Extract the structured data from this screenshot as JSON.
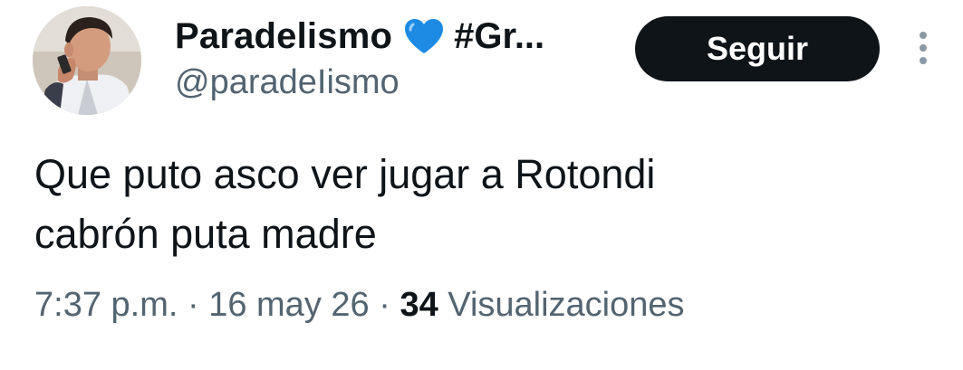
{
  "tweet": {
    "author": {
      "display_name": "Paradelismo",
      "emoji_icon": "blue-heart-icon",
      "name_suffix": "#Gr...",
      "handle": "@paradeIismo",
      "avatar_icon": "avatar-photo"
    },
    "follow_button_label": "Seguir",
    "more_icon": "more-options-icon",
    "text_line_1": "Que puto asco ver jugar a Rotondi",
    "text_line_2": "cabrón puta madre",
    "time": "7:37 p.m.",
    "separator": "·",
    "date": "16 may 26",
    "views_count": "34",
    "views_label": "Visualizaciones"
  },
  "colors": {
    "text_primary": "#0f1419",
    "text_secondary": "#536471",
    "button_bg": "#0f1419",
    "button_text": "#ffffff",
    "heart": "#1d8be4"
  }
}
